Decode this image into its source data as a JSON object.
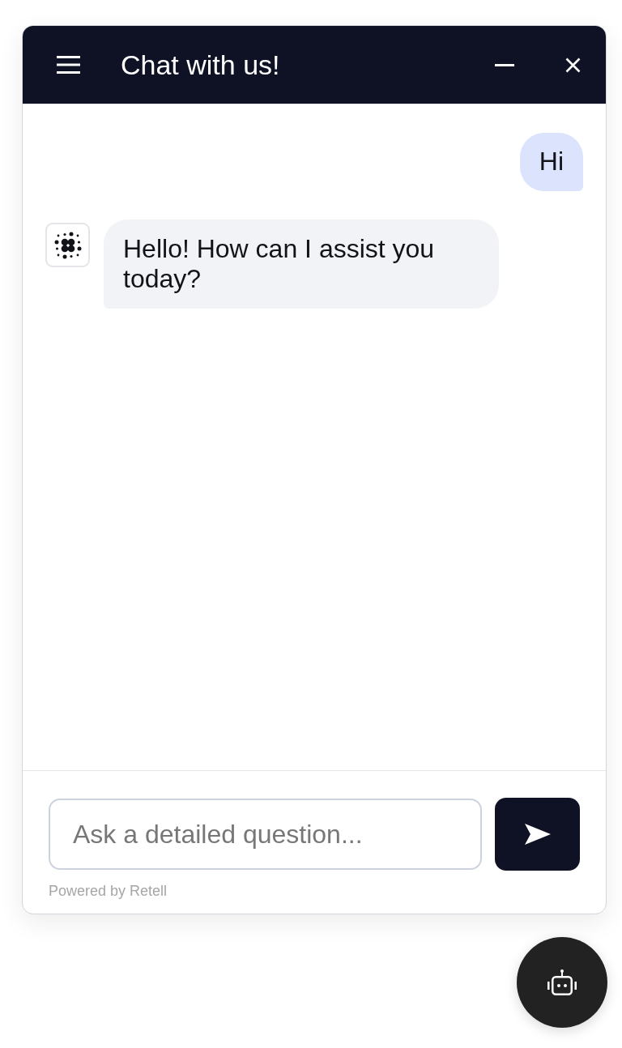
{
  "header": {
    "title": "Chat with us!"
  },
  "messages": [
    {
      "kind": "user",
      "text": "Hi"
    },
    {
      "kind": "bot",
      "text": "Hello! How can I assist you today?"
    }
  ],
  "composer": {
    "placeholder": "Ask a detailed question..."
  },
  "footer": {
    "note": "Powered by Retell"
  }
}
